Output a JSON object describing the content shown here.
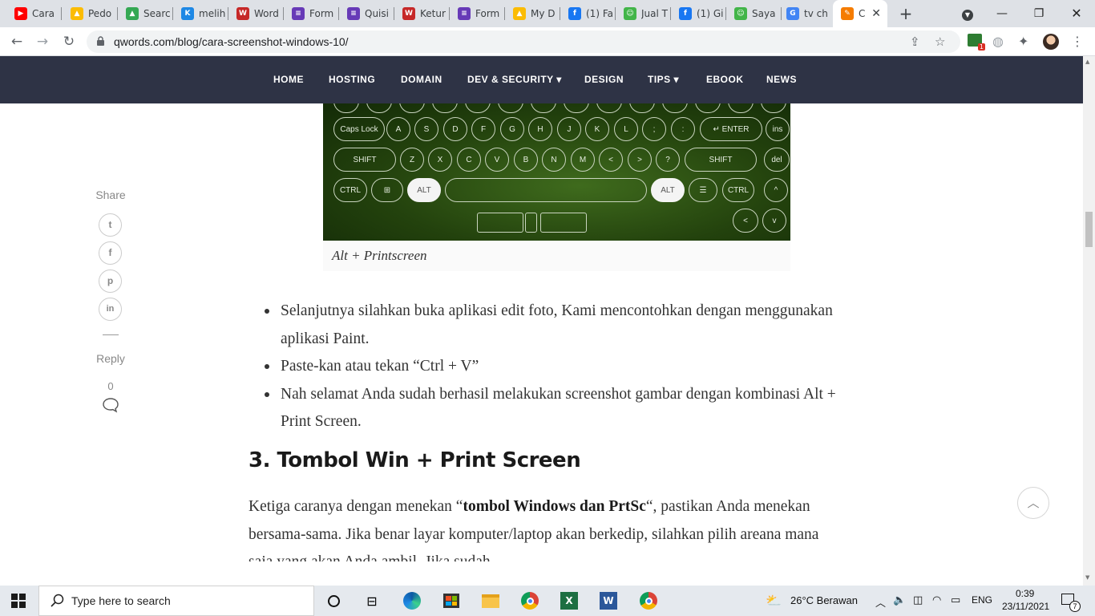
{
  "browser": {
    "tabs": [
      {
        "label": "Cara",
        "icon": "youtube-icon",
        "color": "#ff0000",
        "glyph": "▶"
      },
      {
        "label": "Pedo",
        "icon": "drive-icon",
        "color": "#fbbc04",
        "glyph": "▲"
      },
      {
        "label": "Searc",
        "icon": "drive-icon",
        "color": "#34a853",
        "glyph": "▲"
      },
      {
        "label": "melih",
        "icon": "k-icon",
        "color": "#1e88e5",
        "glyph": "K"
      },
      {
        "label": "Word",
        "icon": "shield-icon",
        "color": "#c62828",
        "glyph": "W"
      },
      {
        "label": "Form",
        "icon": "forms-icon",
        "color": "#673ab7",
        "glyph": "≡"
      },
      {
        "label": "Quisi",
        "icon": "forms-icon",
        "color": "#673ab7",
        "glyph": "≡"
      },
      {
        "label": "Ketur",
        "icon": "shield-icon",
        "color": "#c62828",
        "glyph": "W"
      },
      {
        "label": "Form",
        "icon": "forms-icon",
        "color": "#673ab7",
        "glyph": "≡"
      },
      {
        "label": "My D",
        "icon": "drive-icon",
        "color": "#fbbc04",
        "glyph": "▲"
      },
      {
        "label": "(1) Fa",
        "icon": "facebook-icon",
        "color": "#1877f2",
        "glyph": "f"
      },
      {
        "label": "Jual T",
        "icon": "tokopedia-icon",
        "color": "#42b549",
        "glyph": "☺"
      },
      {
        "label": "(1) Gi",
        "icon": "facebook-icon",
        "color": "#1877f2",
        "glyph": "f"
      },
      {
        "label": "Saya",
        "icon": "tokopedia-icon",
        "color": "#42b549",
        "glyph": "☺"
      },
      {
        "label": "tv ch",
        "icon": "google-icon",
        "color": "#4285f4",
        "glyph": "G"
      },
      {
        "label": "C",
        "icon": "qwords-icon",
        "color": "#f57c00",
        "glyph": "✎"
      }
    ],
    "url": "qwords.com/blog/cara-screenshot-windows-10/"
  },
  "site_nav": [
    "HOME",
    "HOSTING",
    "DOMAIN",
    "DEV & SECURITY ▾",
    "DESIGN",
    "TIPS ▾",
    "EBOOK",
    "NEWS"
  ],
  "keyboard": {
    "row1": [
      "Caps Lock",
      "A",
      "S",
      "D",
      "F",
      "G",
      "H",
      "J",
      "K",
      "L",
      ";",
      ":",
      "↵ ENTER",
      "ins"
    ],
    "row2": [
      "SHIFT",
      "Z",
      "X",
      "C",
      "V",
      "B",
      "N",
      "M",
      "<",
      ">",
      "?",
      "SHIFT",
      "del"
    ],
    "row3": [
      "CTRL",
      "⊞",
      "ALT",
      "",
      "ALT",
      "☰",
      "CTRL",
      "^"
    ],
    "row4": [
      "<",
      "v"
    ]
  },
  "caption": "Alt + Printscreen",
  "share": {
    "label": "Share",
    "reply_label": "Reply",
    "reply_count": "0"
  },
  "bullets": [
    "Selanjutnya silahkan buka aplikasi edit foto, Kami mencontohkan dengan menggunakan aplikasi Paint.",
    "Paste-kan atau tekan “Ctrl + V”",
    "Nah selamat Anda sudah berhasil melakukan screenshot gambar dengan kombinasi Alt + Print Screen."
  ],
  "heading": "3. Tombol Win + Print Screen",
  "paragraph": {
    "before": "Ketiga caranya dengan menekan “",
    "bold": "tombol Windows dan PrtSc",
    "after": "“, pastikan Anda menekan bersama-sama. Jika benar layar komputer/laptop akan berkedip, silahkan pilih areana mana saja yang akan Anda ambil. Jika sudah"
  },
  "taskbar": {
    "search_placeholder": "Type here to search",
    "weather": "26°C  Berawan",
    "lang": "ENG",
    "time": "0:39",
    "date": "23/11/2021",
    "notif_count": "7"
  }
}
